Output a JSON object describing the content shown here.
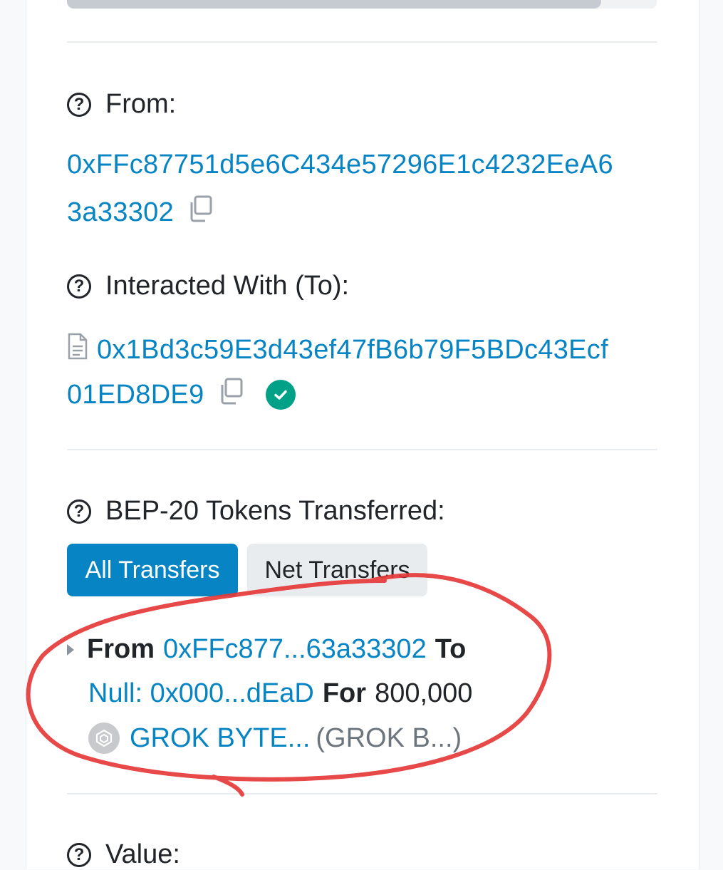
{
  "from": {
    "label": "From:",
    "address_line1": "0xFFc87751d5e6C434e57296E1c4232EeA6",
    "address_line2": "3a33302"
  },
  "interacted": {
    "label": "Interacted With (To):",
    "address_line1": "0x1Bd3c59E3d43ef47fB6b79F5BDc43Ecf",
    "address_line2": "01ED8DE9"
  },
  "tokens": {
    "label": "BEP-20 Tokens Transferred:",
    "tabs": {
      "all": "All Transfers",
      "net": "Net Transfers"
    },
    "transfer": {
      "from_word": "From",
      "from_addr": "0xFFc877...63a33302",
      "to_word": "To",
      "to_addr": "Null: 0x000...dEaD",
      "for_word": "For",
      "amount": "800,000",
      "token_name": "GROK BYTE...",
      "token_symbol": "(GROK B...)"
    }
  },
  "value": {
    "label": "Value:"
  },
  "colors": {
    "link": "#0784c3",
    "primary_button": "#0784c3",
    "verified": "#00a186",
    "annotation": "#e53935"
  },
  "icons": [
    "question-circle-icon",
    "copy-icon",
    "document-icon",
    "verified-check-icon",
    "expand-caret-icon",
    "token-logo-icon"
  ]
}
